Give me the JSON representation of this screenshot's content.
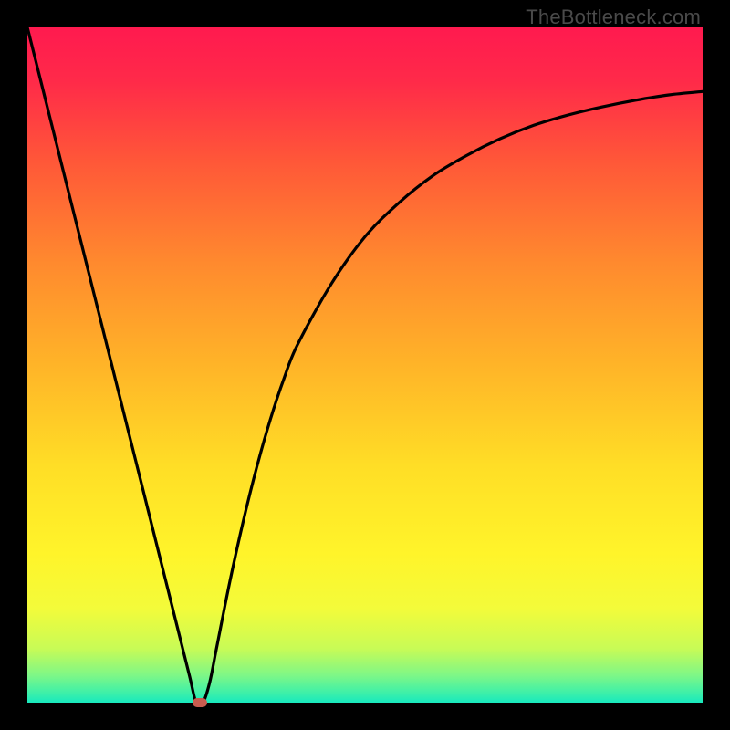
{
  "watermark": {
    "text": "TheBottleneck.com"
  },
  "chart_data": {
    "type": "line",
    "title": "",
    "xlabel": "",
    "ylabel": "",
    "xlim": [
      0,
      100
    ],
    "ylim": [
      0,
      100
    ],
    "x": [
      0,
      2,
      4,
      6,
      8,
      10,
      12,
      14,
      16,
      18,
      20,
      22,
      24,
      25,
      26,
      27,
      28,
      30,
      32,
      34,
      36,
      38,
      40,
      45,
      50,
      55,
      60,
      65,
      70,
      75,
      80,
      85,
      90,
      95,
      100
    ],
    "values": [
      100,
      92,
      84,
      76,
      68,
      60,
      52,
      44,
      36,
      28,
      20,
      12,
      4,
      0,
      0,
      3,
      8,
      18,
      27,
      35,
      42,
      48,
      53,
      62,
      69,
      74,
      78,
      81,
      83.5,
      85.5,
      87,
      88.2,
      89.2,
      90,
      90.5
    ],
    "marker": {
      "x": 25.5,
      "y": 0,
      "color": "#c95c4f"
    },
    "gradient_stops": [
      {
        "offset": 0.0,
        "color": "#ff1a4f"
      },
      {
        "offset": 0.08,
        "color": "#ff2a49"
      },
      {
        "offset": 0.2,
        "color": "#ff5838"
      },
      {
        "offset": 0.35,
        "color": "#ff8a2e"
      },
      {
        "offset": 0.5,
        "color": "#ffb428"
      },
      {
        "offset": 0.65,
        "color": "#ffde26"
      },
      {
        "offset": 0.78,
        "color": "#fff42a"
      },
      {
        "offset": 0.86,
        "color": "#f3fb3a"
      },
      {
        "offset": 0.92,
        "color": "#c8fb56"
      },
      {
        "offset": 0.96,
        "color": "#7df787"
      },
      {
        "offset": 0.985,
        "color": "#3ff0a8"
      },
      {
        "offset": 1.0,
        "color": "#18e9be"
      }
    ]
  }
}
